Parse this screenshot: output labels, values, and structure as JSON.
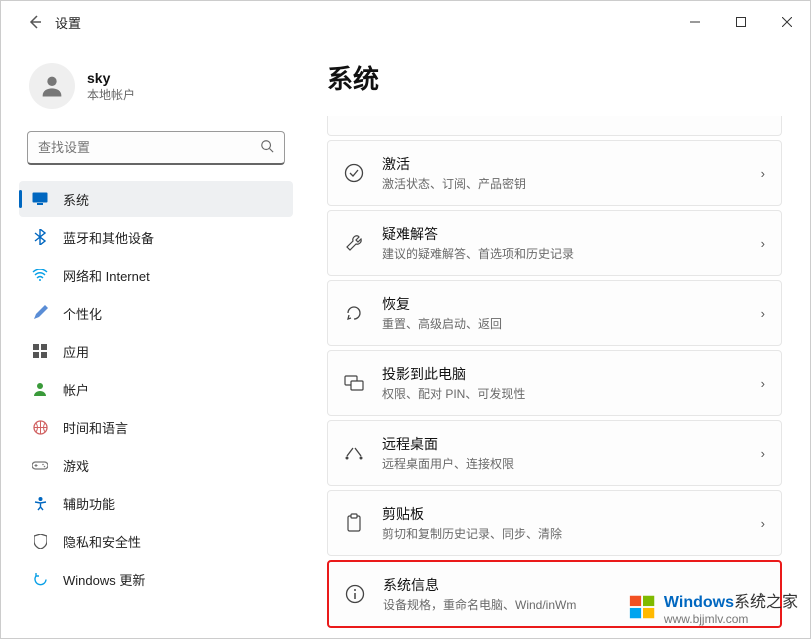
{
  "titlebar": {
    "title": "设置"
  },
  "profile": {
    "name": "sky",
    "sub": "本地帐户"
  },
  "search": {
    "placeholder": "查找设置"
  },
  "nav": {
    "system": "系统",
    "bluetooth": "蓝牙和其他设备",
    "network": "网络和 Internet",
    "personal": "个性化",
    "apps": "应用",
    "accounts": "帐户",
    "time": "时间和语言",
    "gaming": "游戏",
    "accessibility": "辅助功能",
    "privacy": "隐私和安全性",
    "update": "Windows 更新"
  },
  "main": {
    "heading": "系统",
    "cards": {
      "activation": {
        "title": "激活",
        "sub": "激活状态、订阅、产品密钥"
      },
      "troubleshoot": {
        "title": "疑难解答",
        "sub": "建议的疑难解答、首选项和历史记录"
      },
      "recovery": {
        "title": "恢复",
        "sub": "重置、高级启动、返回"
      },
      "project": {
        "title": "投影到此电脑",
        "sub": "权限、配对 PIN、可发现性"
      },
      "remote": {
        "title": "远程桌面",
        "sub": "远程桌面用户、连接权限"
      },
      "clipboard": {
        "title": "剪贴板",
        "sub": "剪切和复制历史记录、同步、清除"
      },
      "about": {
        "title": "系统信息",
        "sub": "设备规格，重命名电脑、Wind/inWm"
      }
    }
  },
  "watermark": {
    "brand1": "Windows",
    "brand2": "系统之家",
    "url": "www.bjjmlv.com"
  }
}
